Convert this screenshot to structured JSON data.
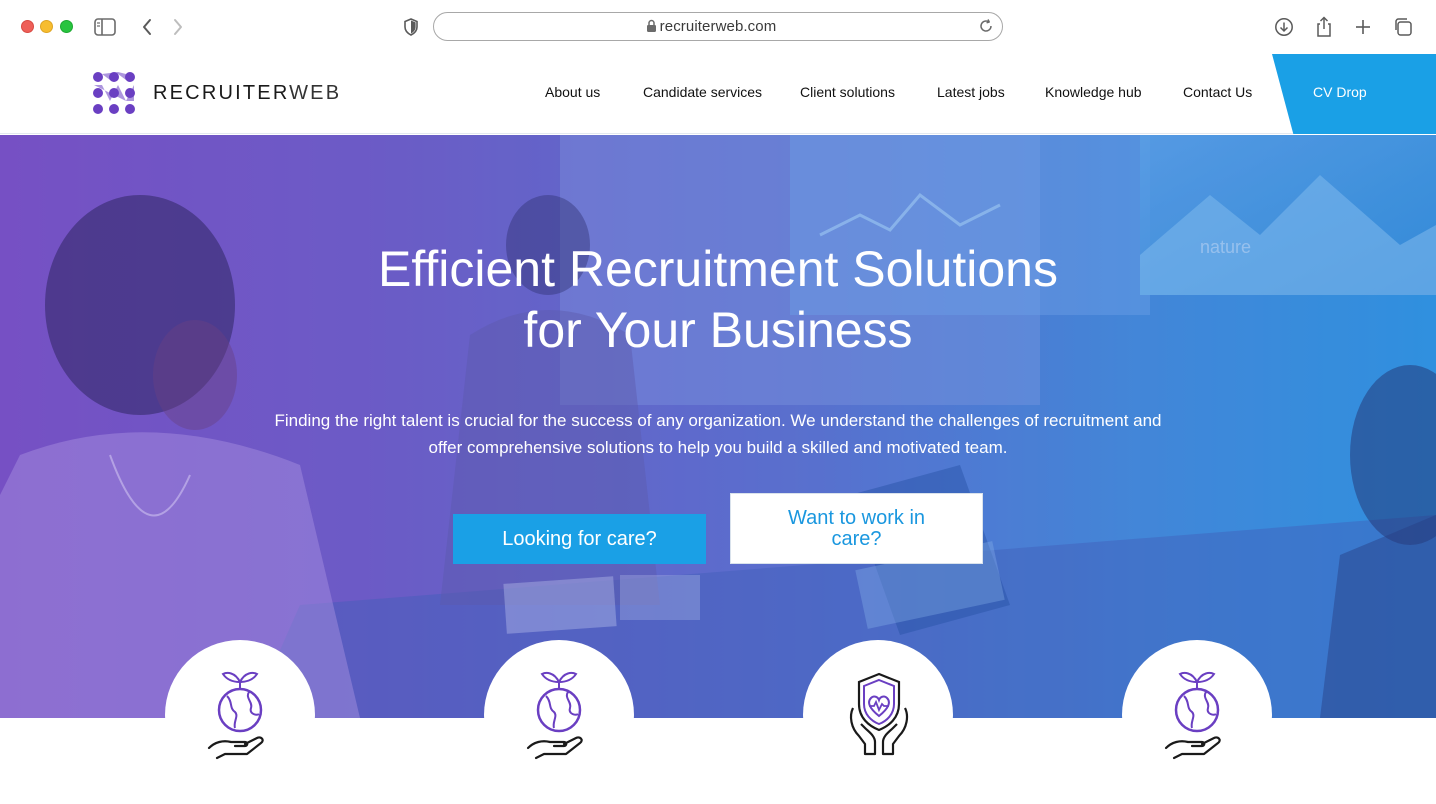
{
  "browser": {
    "url": "recruiterweb.com"
  },
  "site": {
    "logo_text_bold": "RECRUITER",
    "logo_text_light": "WEB",
    "nav": [
      {
        "label": "About us"
      },
      {
        "label": "Candidate services"
      },
      {
        "label": "Client solutions"
      },
      {
        "label": "Latest jobs"
      },
      {
        "label": "Knowledge hub"
      },
      {
        "label": "Contact Us"
      }
    ],
    "cv_drop_label": "CV Drop"
  },
  "hero": {
    "title_line1": "Efficient Recruitment Solutions",
    "title_line2": "for Your Business",
    "subtitle": "Finding the right talent is crucial for the success of any organization. We understand the challenges of recruitment and offer comprehensive solutions to help you build a skilled and motivated team.",
    "primary_button": "Looking for care?",
    "secondary_button": "Want to work in care?"
  },
  "features": [
    {
      "icon": "globe-in-hand-icon"
    },
    {
      "icon": "globe-in-hand-icon"
    },
    {
      "icon": "heart-shield-hands-icon"
    },
    {
      "icon": "globe-in-hand-icon"
    }
  ],
  "colors": {
    "brand_blue": "#1aa0e6",
    "brand_purple": "#6a3fc2",
    "hero_gradient_start": "#7a4fc4",
    "hero_gradient_end": "#2a98e3"
  }
}
